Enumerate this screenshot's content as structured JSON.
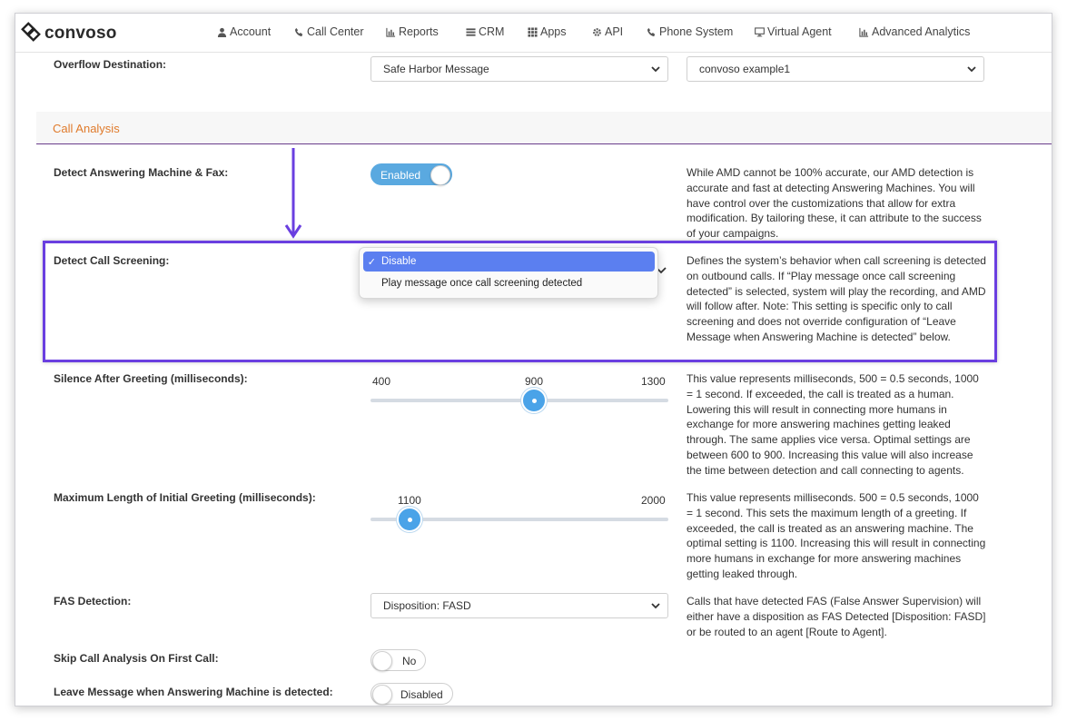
{
  "brand": {
    "name": "convoso",
    "logo_icon": "convoso-logo-icon"
  },
  "nav": [
    {
      "label": "Account",
      "icon": "user-icon"
    },
    {
      "label": "Call Center",
      "icon": "phone-icon"
    },
    {
      "label": "Reports",
      "icon": "bar-chart-icon"
    },
    {
      "label": "CRM",
      "icon": "list-icon"
    },
    {
      "label": "Apps",
      "icon": "grid-icon"
    },
    {
      "label": "API",
      "icon": "gear-icon"
    },
    {
      "label": "Phone System",
      "icon": "phone-icon"
    },
    {
      "label": "Virtual Agent",
      "icon": "monitor-icon"
    },
    {
      "label": "Advanced Analytics",
      "icon": "bar-chart-icon"
    }
  ],
  "overflow": {
    "label": "Overflow Destination:",
    "select1": "Safe Harbor Message",
    "select2": "convoso example1"
  },
  "section": {
    "title": "Call Analysis"
  },
  "amd": {
    "label": "Detect Answering Machine & Fax:",
    "toggle": "Enabled",
    "desc": "While AMD cannot be 100% accurate, our AMD detection is accurate and fast at detecting Answering Machines. You will have control over the customizations that allow for extra modification. By tailoring these, it can attribute to the success of your campaigns."
  },
  "screening": {
    "label": "Detect Call Screening:",
    "options": [
      "Disable",
      "Play message once call screening detected"
    ],
    "selected": "Disable",
    "desc": "Defines the system’s behavior when call screening is detected on outbound calls. If “Play message once call screening detected” is selected, system will play the recording, and AMD will follow after. Note: This setting is specific only to call screening and does not override configuration of “Leave Message when Answering Machine is detected” below."
  },
  "silence": {
    "label": "Silence After Greeting (milliseconds):",
    "min": "400",
    "value": "900",
    "max": "1300",
    "value_fraction": 0.55,
    "desc": "This value represents milliseconds, 500 =  0.5 seconds, 1000 = 1 second. If exceeded, the call is treated as a human. Lowering this will result in connecting more humans in exchange for more answering machines getting leaked through. The same applies vice versa. Optimal settings are between 600 to 900. Increasing this value will also increase the time between detection and call connecting to agents."
  },
  "max_greeting": {
    "label": "Maximum Length of Initial Greeting (milliseconds):",
    "value": "1100",
    "max": "2000",
    "value_fraction": 0.13,
    "desc": "This value represents milliseconds. 500 =  0.5 seconds, 1000 = 1 second. This sets the maximum length of a greeting. If exceeded, the call is treated as an answering machine. The optimal setting is 1100. Increasing this will result in connecting more humans in exchange for more answering machines getting leaked through."
  },
  "fas": {
    "label": "FAS Detection:",
    "select": "Disposition: FASD",
    "desc": "Calls that have detected FAS (False Answer Supervision) will either have a disposition as FAS Detected [Disposition: FASD] or be routed to an agent [Route to Agent]."
  },
  "skip": {
    "label": "Skip Call Analysis On First Call:",
    "toggle": "No"
  },
  "leave": {
    "label": "Leave Message when Answering Machine is detected:",
    "toggle": "Disabled"
  },
  "colors": {
    "accent": "#5aa9e0",
    "highlight": "#6a3fe0",
    "section": "#e07b2c",
    "select_blue": "#5b7ff0"
  }
}
